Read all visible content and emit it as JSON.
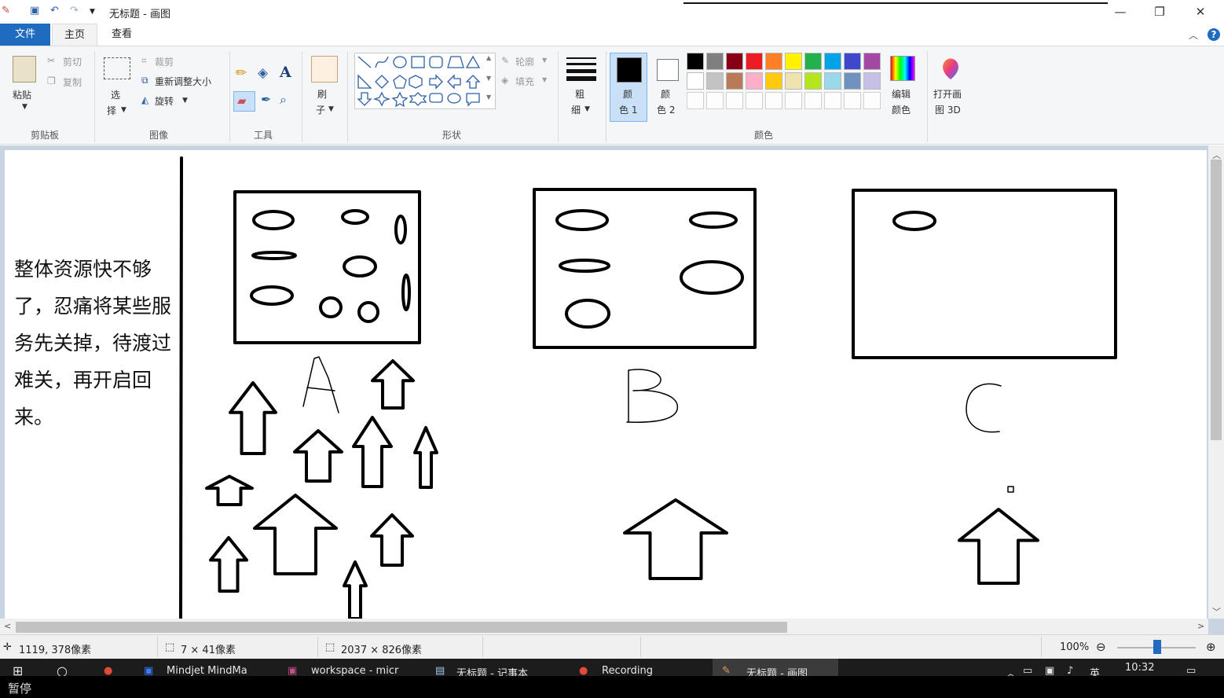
{
  "titlebar": {
    "title": "无标题 - 画图",
    "minimize": "—",
    "restore": "❐",
    "close": "✕"
  },
  "tabs": {
    "file": "文件",
    "home": "主页",
    "view": "查看"
  },
  "ribbon": {
    "clipboard": {
      "paste": "粘贴",
      "cut": "剪切",
      "copy": "复制",
      "label": "剪贴板"
    },
    "image": {
      "select_1": "选",
      "select_2": "择",
      "crop": "裁剪",
      "resize": "重新调整大小",
      "rotate": "旋转",
      "label": "图像"
    },
    "tools": {
      "label": "工具",
      "text": "A"
    },
    "brushes": {
      "label_1": "刷",
      "label_2": "子"
    },
    "shapes": {
      "outline": "轮廓",
      "fill": "填充",
      "label": "形状"
    },
    "size": {
      "label_1": "粗",
      "label_2": "细"
    },
    "color1": {
      "label_1": "颜",
      "label_2": "色 1",
      "value": "#000000"
    },
    "color2": {
      "label_1": "颜",
      "label_2": "色 2",
      "value": "#ffffff"
    },
    "colors": {
      "label": "颜色",
      "row1": [
        "#000000",
        "#7f7f7f",
        "#880015",
        "#ed1c24",
        "#ff7f27",
        "#fff200",
        "#22b14c",
        "#00a2e8",
        "#3f48cc",
        "#a349a4"
      ],
      "row2": [
        "#ffffff",
        "#c3c3c3",
        "#b97a57",
        "#ffaec9",
        "#ffc90e",
        "#efe4b0",
        "#b5e61d",
        "#99d9ea",
        "#7092be",
        "#c8bfe7"
      ]
    },
    "edit_colors": {
      "label_1": "编辑",
      "label_2": "颜色"
    },
    "paint3d": {
      "label_1": "打开画",
      "label_2": "图 3D"
    }
  },
  "canvas": {
    "note": "整体资源快不够了，忍痛将某些服务先关掉，待渡过难关，再开启回来。",
    "labels": {
      "a": "A",
      "b": "B",
      "c": "C"
    }
  },
  "status": {
    "cursor": "1119, 378像素",
    "selection": "7 × 41像素",
    "size": "2037 × 826像素",
    "zoom": "100%"
  },
  "taskbar": {
    "items": [
      "Mindjet MindMa",
      "workspace - micr",
      "无标题 - 记事本",
      "Recording",
      "无标题 - 画图"
    ],
    "clock": "10:32",
    "ime": "英"
  },
  "overlay": {
    "pause": "暂停"
  }
}
